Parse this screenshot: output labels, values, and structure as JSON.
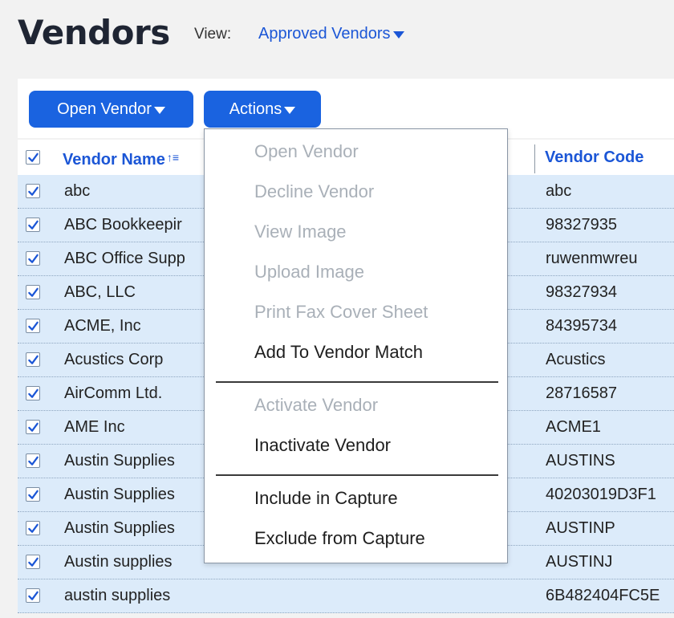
{
  "header": {
    "title": "Vendors",
    "view_label": "View:",
    "view_value": "Approved Vendors"
  },
  "toolbar": {
    "open_vendor_label": "Open Vendor",
    "actions_label": "Actions"
  },
  "table": {
    "columns": [
      "Vendor Name",
      "Vendor Code"
    ],
    "rows": [
      {
        "name": "abc",
        "code": "abc",
        "checked": true
      },
      {
        "name": "ABC Bookkeepir",
        "code": "98327935",
        "checked": true
      },
      {
        "name": "ABC Office Supp",
        "code": "ruwenmwreu",
        "checked": true
      },
      {
        "name": "ABC, LLC",
        "code": "98327934",
        "checked": true
      },
      {
        "name": "ACME, Inc",
        "code": "84395734",
        "checked": true
      },
      {
        "name": "Acustics Corp",
        "code": "Acustics",
        "checked": true
      },
      {
        "name": "AirComm Ltd.",
        "code": "28716587",
        "checked": true
      },
      {
        "name": "AME Inc",
        "code": "ACME1",
        "checked": true
      },
      {
        "name": "Austin Supplies",
        "code": "AUSTINS",
        "checked": true
      },
      {
        "name": "Austin Supplies",
        "code": "40203019D3F1",
        "checked": true
      },
      {
        "name": "Austin Supplies",
        "code": "AUSTINP",
        "checked": true
      },
      {
        "name": "Austin supplies",
        "code": "AUSTINJ",
        "checked": true
      },
      {
        "name": "austin supplies",
        "code": "6B482404FC5E",
        "checked": true
      }
    ]
  },
  "actions_menu": {
    "items": [
      {
        "label": "Open Vendor",
        "enabled": false
      },
      {
        "label": "Decline Vendor",
        "enabled": false
      },
      {
        "label": "View Image",
        "enabled": false
      },
      {
        "label": "Upload Image",
        "enabled": false
      },
      {
        "label": "Print Fax Cover Sheet",
        "enabled": false
      },
      {
        "label": "Add To Vendor Match",
        "enabled": true
      },
      {
        "label": "Activate Vendor",
        "enabled": false
      },
      {
        "label": "Inactivate Vendor",
        "enabled": true
      },
      {
        "label": "Include in Capture",
        "enabled": true
      },
      {
        "label": "Exclude from Capture",
        "enabled": true
      }
    ]
  },
  "colors": {
    "accent": "#1a63e0",
    "row_selected": "#dcebfa",
    "disabled_text": "#a9b0b8"
  }
}
